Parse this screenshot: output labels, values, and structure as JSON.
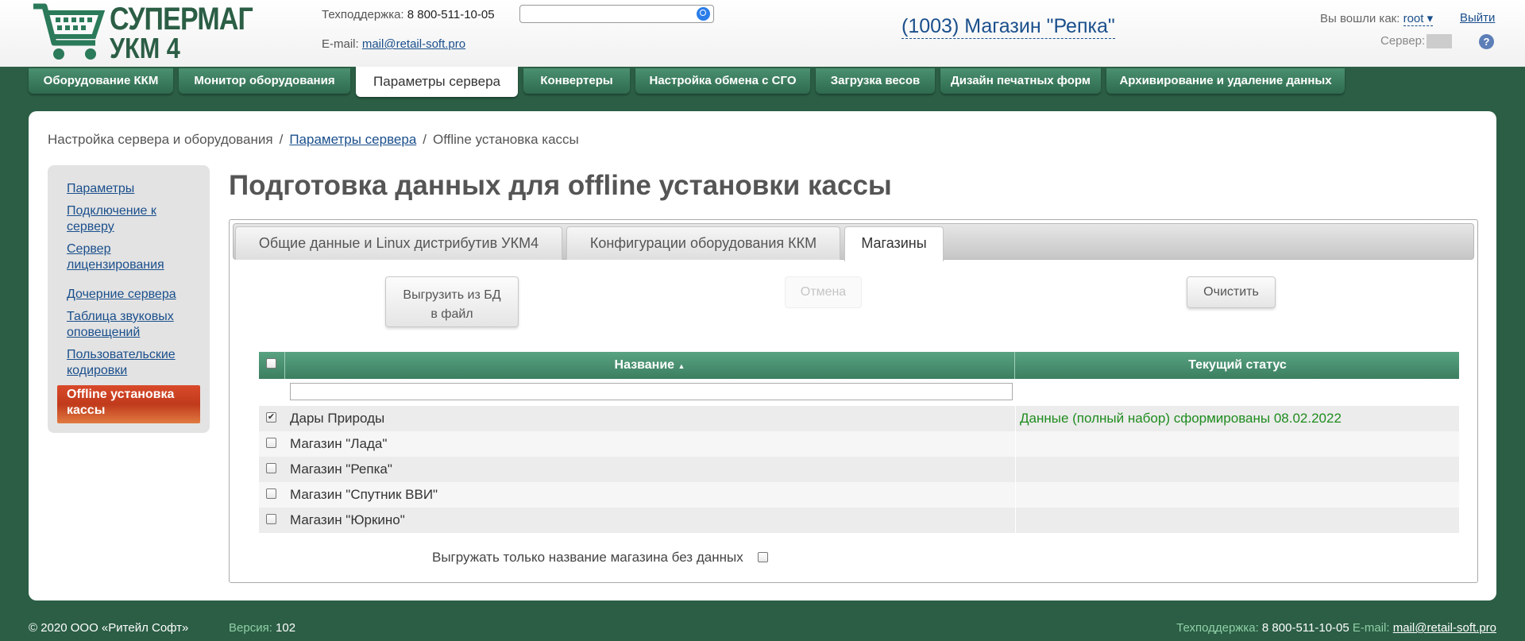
{
  "header": {
    "logo_line1": "СУПЕРМАГ",
    "logo_line2": "УКМ 4",
    "support_label": "Техподдержка:",
    "support_phone": "8 800-511-10-05",
    "email_label": "E-mail:",
    "email": "mail@retail-soft.pro",
    "search_placeholder": "",
    "store_title": "(1003) Магазин \"Репка\"",
    "login_label": "Вы вошли как:",
    "user": "root ▾",
    "logout": "Выйти",
    "server_label": "Сервер:",
    "help": "?"
  },
  "nav": [
    "Оборудование ККМ",
    "Монитор оборудования",
    "Параметры сервера",
    "Конвертеры",
    "Настройка обмена с СГО",
    "Загрузка весов",
    "Дизайн печатных форм",
    "Архивирование и удаление данных"
  ],
  "breadcrumb": {
    "root": "Настройка сервера и оборудования",
    "sep": "/",
    "parent": "Параметры сервера",
    "current": "Offline установка кассы"
  },
  "sidebar": [
    "Параметры",
    "Подключение к серверу",
    "Сервер лицензирования",
    "Дочерние сервера",
    "Таблица звуковых оповещений",
    "Пользовательские кодировки",
    "Offline установка кассы"
  ],
  "page_title": "Подготовка данных для offline установки кассы",
  "tabs": [
    "Общие данные и Linux дистрибутив УКМ4",
    "Конфигурации оборудования ККМ",
    "Магазины"
  ],
  "buttons": {
    "export_line1": "Выгрузить из БД",
    "export_line2": "в файл",
    "cancel": "Отмена",
    "clear": "Очистить"
  },
  "grid": {
    "col_name": "Название",
    "col_status": "Текущий статус",
    "sort_indicator": "▲",
    "rows": [
      {
        "checked": true,
        "name": "Дары Природы",
        "status": "Данные (полный набор) сформированы 08.02.2022"
      },
      {
        "checked": false,
        "name": "Магазин \"Лада\"",
        "status": ""
      },
      {
        "checked": false,
        "name": "Магазин \"Репка\"",
        "status": ""
      },
      {
        "checked": false,
        "name": "Магазин \"Спутник ВВИ\"",
        "status": ""
      },
      {
        "checked": false,
        "name": "Магазин \"Юркино\"",
        "status": ""
      }
    ]
  },
  "export_only_label": "Выгружать только название магазина без данных",
  "footer": {
    "copyright": "© 2020 ООО «Ритейл Софт»",
    "version_label": "Версия:",
    "version": "102",
    "support_label": "Техподдержка:",
    "support_phone": "8 800-511-10-05",
    "email_label": "E-mail:",
    "email": "mail@retail-soft.pro"
  }
}
